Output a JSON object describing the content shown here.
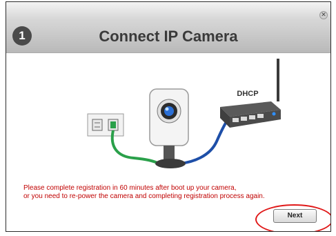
{
  "window": {
    "close_glyph": "✕"
  },
  "header": {
    "step_number": "1",
    "title": "Connect IP Camera"
  },
  "illustration": {
    "router_label": "DHCP",
    "icons": [
      "power-outlet-icon",
      "ip-camera-icon",
      "router-icon",
      "ethernet-cable-icon"
    ],
    "colors": {
      "green_cable": "#2aa04a",
      "blue_cable": "#1e4fa8",
      "router_led": "#2f8fff"
    }
  },
  "message": {
    "line1": "Please complete registration in 60 minutes after boot up your camera,",
    "line2": "or you need to re-power the camera and completing registration process again."
  },
  "footer": {
    "next_label": "Next"
  },
  "accent_colors": {
    "message_text": "#c00000",
    "highlight_ring": "#e01818"
  }
}
